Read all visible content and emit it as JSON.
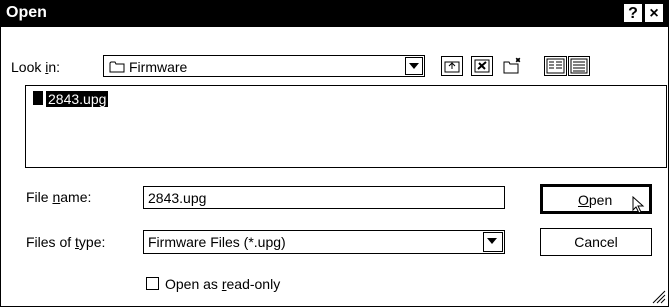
{
  "titlebar": {
    "title": "Open",
    "help_label": "?",
    "close_label": "×"
  },
  "lookin": {
    "label_prefix": "Look ",
    "label_underline": "i",
    "label_suffix": "n:",
    "value": "Firmware"
  },
  "files": [
    {
      "name": "2843.upg",
      "selected": true
    }
  ],
  "filename": {
    "label_prefix": "File ",
    "label_underline": "n",
    "label_suffix": "ame:",
    "value": "2843.upg"
  },
  "filetype": {
    "label_prefix": "Files of ",
    "label_underline": "t",
    "label_suffix": "ype:",
    "value": "Firmware Files (*.upg)"
  },
  "buttons": {
    "open_underline": "O",
    "open_rest": "pen",
    "cancel": "Cancel"
  },
  "readonly": {
    "label_prefix": "Open as ",
    "label_underline": "r",
    "label_suffix": "ead-only",
    "checked": false
  },
  "icons": {
    "folder": "folder-icon",
    "up_folder": "up-folder-icon",
    "desktop": "desktop-icon",
    "new_folder": "new-folder-icon",
    "list_view": "list-view-icon",
    "details_view": "details-view-icon"
  }
}
